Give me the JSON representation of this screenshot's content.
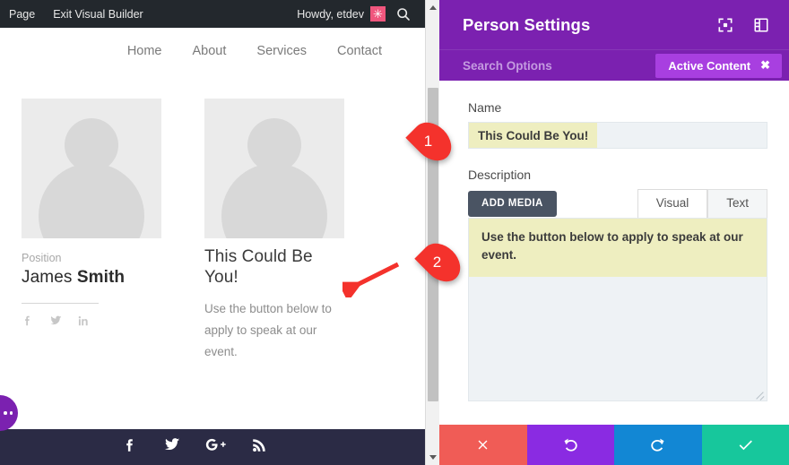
{
  "admin_bar": {
    "page_label": "Page",
    "exit_label": "Exit Visual Builder",
    "howdy": "Howdy, etdev",
    "avatar_glyph": "✳",
    "search_icon": "search-icon"
  },
  "site_nav": {
    "items": [
      {
        "label": "Home"
      },
      {
        "label": "About"
      },
      {
        "label": "Services"
      },
      {
        "label": "Contact"
      }
    ]
  },
  "persons": [
    {
      "position": "Position",
      "name_first": "James ",
      "name_last": "Smith",
      "socials": [
        "facebook-icon",
        "twitter-icon",
        "linkedin-icon"
      ]
    },
    {
      "title": "This Could Be You!",
      "description": "Use the button below to apply to speak at our event."
    }
  ],
  "site_footer": {
    "socials": [
      "facebook-icon",
      "twitter-icon",
      "googleplus-icon",
      "rss-icon"
    ],
    "background": "#2b2b45"
  },
  "fab": {
    "name": "visual-builder-menu-fab",
    "color": "#7b21b0"
  },
  "settings": {
    "title": "Person Settings",
    "accent": "#7b21b0",
    "header_icons": [
      "focus-mode-icon",
      "panel-layout-icon"
    ],
    "search_placeholder": "Search Options",
    "active_content_label": "Active Content",
    "active_content_close": "✖",
    "active_content_color": "#a83fe0",
    "name_label": "Name",
    "name_value": "This Could Be You!",
    "description_label": "Description",
    "add_media_label": "ADD MEDIA",
    "editor_tabs": [
      {
        "label": "Visual",
        "active": true
      },
      {
        "label": "Text",
        "active": false
      }
    ],
    "description_value": "Use the button below to apply to speak at our event.",
    "highlight_color": "#eeeec0",
    "actions": [
      {
        "name": "cancel-button",
        "icon": "close-icon",
        "color": "#f05c56"
      },
      {
        "name": "undo-button",
        "icon": "undo-icon",
        "color": "#8a2be2"
      },
      {
        "name": "redo-button",
        "icon": "redo-icon",
        "color": "#1287d4"
      },
      {
        "name": "save-button",
        "icon": "check-icon",
        "color": "#17c79c"
      }
    ]
  },
  "callouts": [
    {
      "number": "1",
      "color": "#f4322c"
    },
    {
      "number": "2",
      "color": "#f4322c"
    }
  ],
  "annotation_arrow": {
    "name": "red-arrow-annotation",
    "color": "#f4322c"
  },
  "scrollbar": {
    "name": "preview-scrollbar"
  }
}
